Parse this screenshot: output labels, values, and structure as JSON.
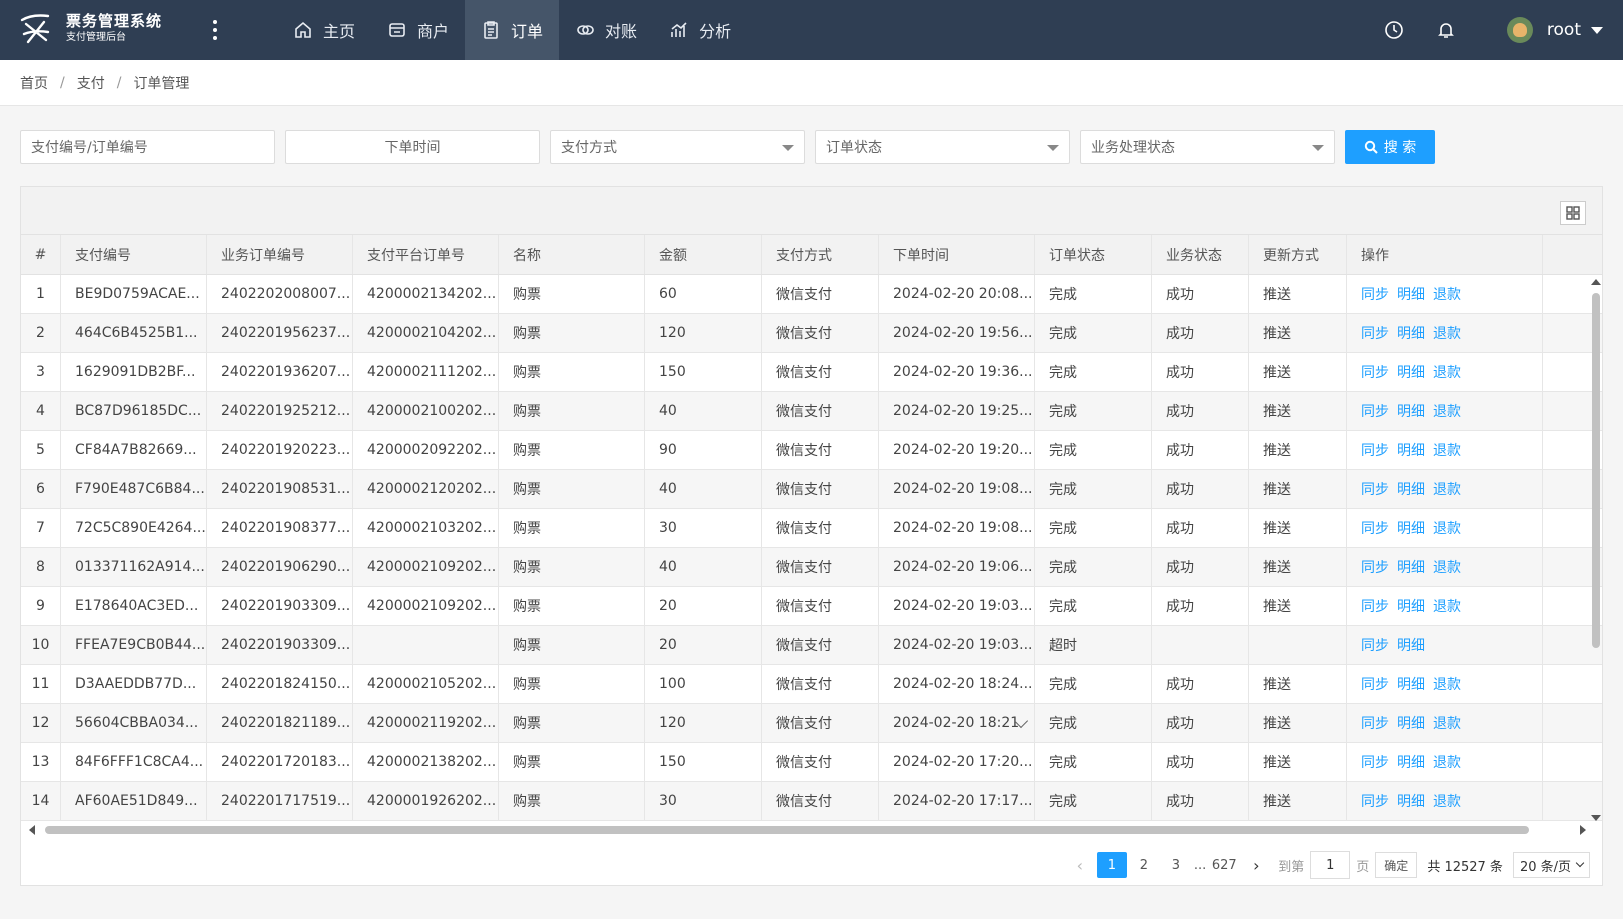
{
  "app": {
    "title": "票务管理系统",
    "subtitle": "支付管理后台"
  },
  "nav": [
    {
      "label": "主页",
      "icon": "home-icon"
    },
    {
      "label": "商户",
      "icon": "merchant-icon"
    },
    {
      "label": "订单",
      "icon": "order-icon",
      "active": true
    },
    {
      "label": "对账",
      "icon": "reconcile-icon"
    },
    {
      "label": "分析",
      "icon": "analytics-icon"
    }
  ],
  "user": {
    "name": "root"
  },
  "breadcrumb": [
    "首页",
    "支付",
    "订单管理"
  ],
  "filters": {
    "order_no_placeholder": "支付编号/订单编号",
    "time_placeholder": "下单时间",
    "pay_method_placeholder": "支付方式",
    "order_status_placeholder": "订单状态",
    "biz_status_placeholder": "业务处理状态",
    "search_label": "搜 索"
  },
  "table": {
    "columns": [
      "#",
      "支付编号",
      "业务订单编号",
      "支付平台订单号",
      "名称",
      "金额",
      "支付方式",
      "下单时间",
      "订单状态",
      "业务状态",
      "更新方式",
      "操作"
    ],
    "rows": [
      [
        "1",
        "BE9D0759ACAE...",
        "2402202008007...",
        "4200002134202...",
        "购票",
        "60",
        "微信支付",
        "2024-02-20 20:08...",
        "完成",
        "成功",
        "推送",
        [
          "同步",
          "明细",
          "退款"
        ]
      ],
      [
        "2",
        "464C6B4525B1...",
        "2402201956237...",
        "4200002104202...",
        "购票",
        "120",
        "微信支付",
        "2024-02-20 19:56...",
        "完成",
        "成功",
        "推送",
        [
          "同步",
          "明细",
          "退款"
        ]
      ],
      [
        "3",
        "1629091DB2BF...",
        "2402201936207...",
        "4200002111202...",
        "购票",
        "150",
        "微信支付",
        "2024-02-20 19:36...",
        "完成",
        "成功",
        "推送",
        [
          "同步",
          "明细",
          "退款"
        ]
      ],
      [
        "4",
        "BC87D96185DC...",
        "2402201925212...",
        "4200002100202...",
        "购票",
        "40",
        "微信支付",
        "2024-02-20 19:25...",
        "完成",
        "成功",
        "推送",
        [
          "同步",
          "明细",
          "退款"
        ]
      ],
      [
        "5",
        "CF84A7B82669...",
        "2402201920223...",
        "4200002092202...",
        "购票",
        "90",
        "微信支付",
        "2024-02-20 19:20...",
        "完成",
        "成功",
        "推送",
        [
          "同步",
          "明细",
          "退款"
        ]
      ],
      [
        "6",
        "F790E487C6B84...",
        "2402201908531...",
        "4200002120202...",
        "购票",
        "40",
        "微信支付",
        "2024-02-20 19:08...",
        "完成",
        "成功",
        "推送",
        [
          "同步",
          "明细",
          "退款"
        ]
      ],
      [
        "7",
        "72C5C890E4264...",
        "2402201908377...",
        "4200002103202...",
        "购票",
        "30",
        "微信支付",
        "2024-02-20 19:08...",
        "完成",
        "成功",
        "推送",
        [
          "同步",
          "明细",
          "退款"
        ]
      ],
      [
        "8",
        "013371162A914...",
        "2402201906290...",
        "4200002109202...",
        "购票",
        "40",
        "微信支付",
        "2024-02-20 19:06...",
        "完成",
        "成功",
        "推送",
        [
          "同步",
          "明细",
          "退款"
        ]
      ],
      [
        "9",
        "E178640AC3ED...",
        "2402201903309...",
        "4200002109202...",
        "购票",
        "20",
        "微信支付",
        "2024-02-20 19:03...",
        "完成",
        "成功",
        "推送",
        [
          "同步",
          "明细",
          "退款"
        ]
      ],
      [
        "10",
        "FFEA7E9CB0B44...",
        "2402201903309...",
        "",
        "购票",
        "20",
        "微信支付",
        "2024-02-20 19:03...",
        "超时",
        "",
        "",
        [
          "同步",
          "明细"
        ]
      ],
      [
        "11",
        "D3AAEDDB77D...",
        "2402201824150...",
        "4200002105202...",
        "购票",
        "100",
        "微信支付",
        "2024-02-20 18:24...",
        "完成",
        "成功",
        "推送",
        [
          "同步",
          "明细",
          "退款"
        ]
      ],
      [
        "12",
        "56604CBBA034...",
        "2402201821189...",
        "4200002119202...",
        "购票",
        "120",
        "微信支付",
        "2024-02-20 18:21",
        "完成",
        "成功",
        "推送",
        [
          "同步",
          "明细",
          "退款"
        ]
      ],
      [
        "13",
        "84F6FFF1C8CA4...",
        "2402201720183...",
        "4200002138202...",
        "购票",
        "150",
        "微信支付",
        "2024-02-20 17:20...",
        "完成",
        "成功",
        "推送",
        [
          "同步",
          "明细",
          "退款"
        ]
      ],
      [
        "14",
        "AF60AE51D849...",
        "2402201717519...",
        "4200001926202...",
        "购票",
        "30",
        "微信支付",
        "2024-02-20 17:17...",
        "完成",
        "成功",
        "推送",
        [
          "同步",
          "明细",
          "退款"
        ]
      ]
    ]
  },
  "pager": {
    "pages": [
      "1",
      "2",
      "3"
    ],
    "ellipsis": "...",
    "last_page": "627",
    "goto_label": "到第",
    "goto_value": "1",
    "page_unit": "页",
    "confirm_label": "确定",
    "total_text": "共 12527 条",
    "page_size": "20 条/页"
  },
  "colors": {
    "topbar": "#2f3e53",
    "accent": "#1e9fff"
  }
}
